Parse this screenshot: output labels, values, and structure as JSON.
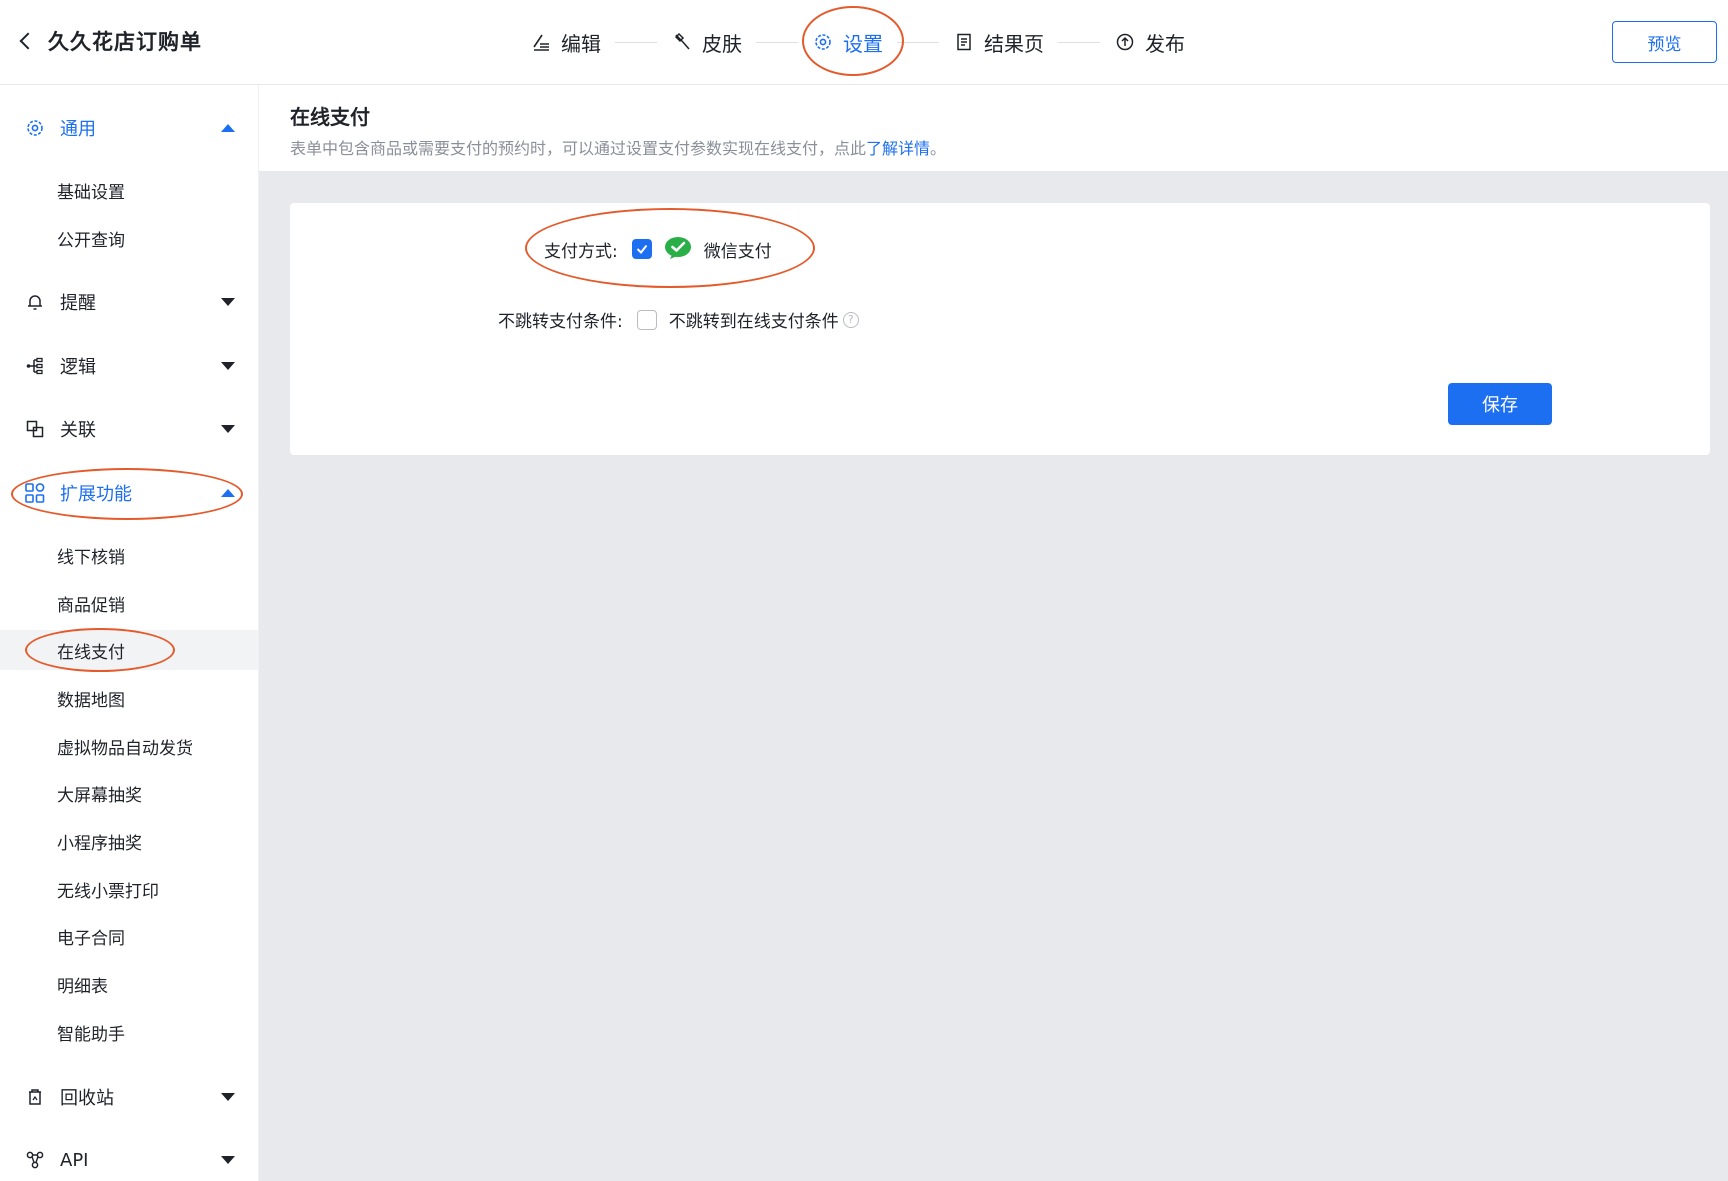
{
  "header": {
    "back_title": "久久花店订购单",
    "steps": [
      {
        "label": "编辑"
      },
      {
        "label": "皮肤"
      },
      {
        "label": "设置"
      },
      {
        "label": "结果页"
      },
      {
        "label": "发布"
      }
    ],
    "preview_label": "预览"
  },
  "sidebar": {
    "general": {
      "label": "通用",
      "items": [
        "基础设置",
        "公开查询"
      ]
    },
    "remind": {
      "label": "提醒"
    },
    "logic": {
      "label": "逻辑"
    },
    "relation": {
      "label": "关联"
    },
    "extension": {
      "label": "扩展功能",
      "items": [
        "线下核销",
        "商品促销",
        "在线支付",
        "数据地图",
        "虚拟物品自动发货",
        "大屏幕抽奖",
        "小程序抽奖",
        "无线小票打印",
        "电子合同",
        "明细表",
        "智能助手"
      ]
    },
    "recycle": {
      "label": "回收站"
    },
    "api": {
      "label": "API"
    }
  },
  "main": {
    "title": "在线支付",
    "desc_text": "表单中包含商品或需要支付的预约时，可以通过设置支付参数实现在线支付，点此",
    "desc_link": "了解详情",
    "desc_end": "。",
    "payment_label": "支付方式:",
    "payment_option": "微信支付",
    "noskip_label": "不跳转支付条件:",
    "noskip_option": "不跳转到在线支付条件",
    "save_label": "保存"
  },
  "colors": {
    "accent": "#1d6ff2",
    "annotation": "#e55a2b",
    "wechat": "#2aae47"
  }
}
